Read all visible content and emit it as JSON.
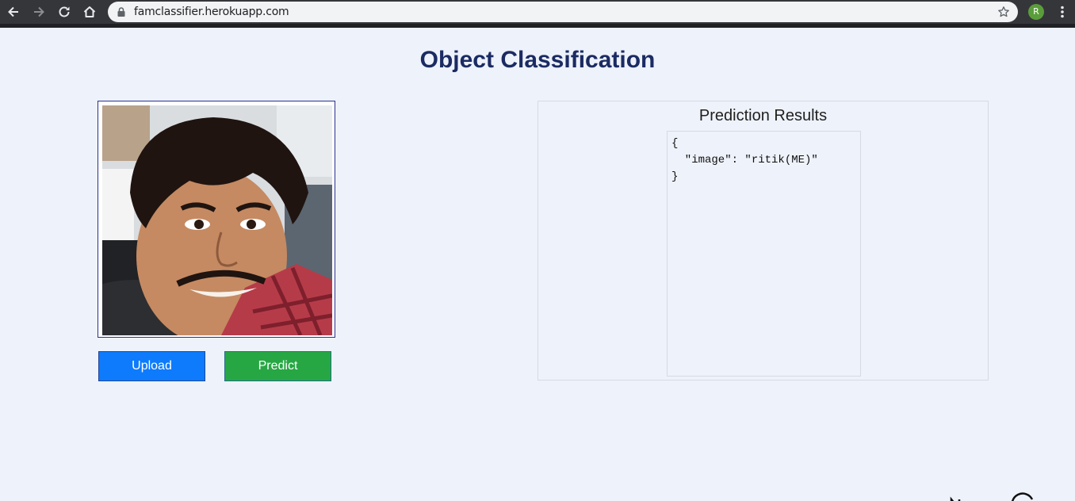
{
  "browser": {
    "url": "famclassifier.herokuapp.com",
    "profile_initial": "R",
    "icons": {
      "back": "arrow-left-icon",
      "forward": "arrow-right-icon",
      "reload": "reload-icon",
      "home": "home-icon",
      "secure": "lock-icon",
      "bookmark": "star-icon",
      "menu": "kebab-menu-icon"
    }
  },
  "page": {
    "title": "Object Classification",
    "colors": {
      "background": "#eef2fa",
      "title": "#1b2b63",
      "upload_button": "#0d7bfc",
      "predict_button": "#27a744"
    }
  },
  "image_panel": {
    "upload_label": "Upload",
    "predict_label": "Predict"
  },
  "results": {
    "title": "Prediction Results",
    "json_lines": [
      "{",
      "  \"image\": \"ritik(ME)\"",
      "}"
    ]
  }
}
